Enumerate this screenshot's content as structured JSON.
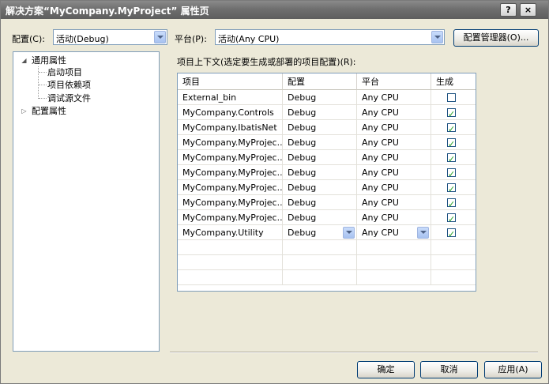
{
  "window": {
    "title": "解决方案“MyCompany.MyProject” 属性页",
    "help_btn": "?",
    "close_btn": "×"
  },
  "toolbar": {
    "config_label": "配置(C):",
    "config_value": "活动(Debug)",
    "platform_label": "平台(P):",
    "platform_value": "活动(Any CPU)",
    "config_manager_label": "配置管理器(O)..."
  },
  "tree": {
    "common": "通用属性",
    "startup": "启动项目",
    "dependencies": "项目依赖项",
    "debug_source": "调试源文件",
    "config_props": "配置属性"
  },
  "panel": {
    "heading": "项目上下文(选定要生成或部署的项目配置)(R):"
  },
  "grid": {
    "columns": [
      "项目",
      "配置",
      "平台",
      "生成"
    ],
    "rows": [
      {
        "project": "External_bin",
        "config": "Debug",
        "platform": "Any CPU",
        "build": false
      },
      {
        "project": "MyCompany.Controls",
        "config": "Debug",
        "platform": "Any CPU",
        "build": true
      },
      {
        "project": "MyCompany.IbatisNet",
        "config": "Debug",
        "platform": "Any CPU",
        "build": true
      },
      {
        "project": "MyCompany.MyProjec...",
        "config": "Debug",
        "platform": "Any CPU",
        "build": true
      },
      {
        "project": "MyCompany.MyProjec...",
        "config": "Debug",
        "platform": "Any CPU",
        "build": true
      },
      {
        "project": "MyCompany.MyProjec...",
        "config": "Debug",
        "platform": "Any CPU",
        "build": true
      },
      {
        "project": "MyCompany.MyProjec...",
        "config": "Debug",
        "platform": "Any CPU",
        "build": true
      },
      {
        "project": "MyCompany.MyProjec...",
        "config": "Debug",
        "platform": "Any CPU",
        "build": true
      },
      {
        "project": "MyCompany.MyProjec...",
        "config": "Debug",
        "platform": "Any CPU",
        "build": true
      },
      {
        "project": "MyCompany.Utility",
        "config": "Debug",
        "platform": "Any CPU",
        "build": true
      }
    ]
  },
  "footer": {
    "ok": "确定",
    "cancel": "取消",
    "apply": "应用(A)"
  }
}
